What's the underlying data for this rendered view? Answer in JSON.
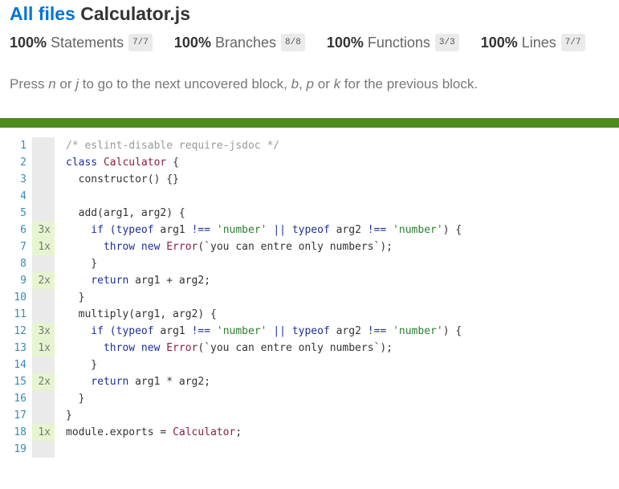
{
  "header": {
    "breadcrumb_label": "All files",
    "file_name": "Calculator.js"
  },
  "stats": [
    {
      "pct": "100%",
      "label": "Statements",
      "fraction": "7/7"
    },
    {
      "pct": "100%",
      "label": "Branches",
      "fraction": "8/8"
    },
    {
      "pct": "100%",
      "label": "Functions",
      "fraction": "3/3"
    },
    {
      "pct": "100%",
      "label": "Lines",
      "fraction": "7/7"
    }
  ],
  "hint": {
    "prefix": "Press ",
    "key_n": "n",
    "or1": " or ",
    "key_j": "j",
    "mid": " to go to the next uncovered block, ",
    "key_b": "b",
    "comma": ", ",
    "key_p": "p",
    "or2": " or ",
    "key_k": "k",
    "suffix": " for the previous block."
  },
  "colors": {
    "status_bar": "#4d8b1f",
    "link": "#0074d9",
    "covered_bg": "#e6f5d0",
    "gutter_bg": "#eaeaea"
  },
  "code": {
    "lines": [
      {
        "num": "1",
        "count": "",
        "tokens": [
          {
            "t": "/* eslint-disable require-jsdoc */",
            "c": "comment"
          }
        ]
      },
      {
        "num": "2",
        "count": "",
        "tokens": [
          {
            "t": "class ",
            "c": "kw"
          },
          {
            "t": "Calculator",
            "c": "cls"
          },
          {
            "t": " {",
            "c": "punc"
          }
        ]
      },
      {
        "num": "3",
        "count": "",
        "tokens": [
          {
            "t": "  constructor() {}",
            "c": "fn"
          }
        ]
      },
      {
        "num": "4",
        "count": "",
        "tokens": []
      },
      {
        "num": "5",
        "count": "",
        "tokens": [
          {
            "t": "  add(arg1, arg2) {",
            "c": "fn"
          }
        ]
      },
      {
        "num": "6",
        "count": "3x",
        "tokens": [
          {
            "t": "    if (",
            "c": "kw"
          },
          {
            "t": "typeof",
            "c": "kw"
          },
          {
            "t": " arg1 ",
            "c": "fn"
          },
          {
            "t": "!==",
            "c": "kw"
          },
          {
            "t": " ",
            "c": "fn"
          },
          {
            "t": "'number'",
            "c": "str"
          },
          {
            "t": " || ",
            "c": "kw"
          },
          {
            "t": "typeof",
            "c": "kw"
          },
          {
            "t": " arg2 ",
            "c": "fn"
          },
          {
            "t": "!==",
            "c": "kw"
          },
          {
            "t": " ",
            "c": "fn"
          },
          {
            "t": "'number'",
            "c": "str"
          },
          {
            "t": ") {",
            "c": "punc"
          }
        ]
      },
      {
        "num": "7",
        "count": "1x",
        "tokens": [
          {
            "t": "      throw new ",
            "c": "kw"
          },
          {
            "t": "Error",
            "c": "cls"
          },
          {
            "t": "(`you can entre only numbers`);",
            "c": "fn"
          }
        ]
      },
      {
        "num": "8",
        "count": "",
        "tokens": [
          {
            "t": "    }",
            "c": "punc"
          }
        ]
      },
      {
        "num": "9",
        "count": "2x",
        "tokens": [
          {
            "t": "    return",
            "c": "kw"
          },
          {
            "t": " arg1 + arg2;",
            "c": "fn"
          }
        ]
      },
      {
        "num": "10",
        "count": "",
        "tokens": [
          {
            "t": "  }",
            "c": "punc"
          }
        ]
      },
      {
        "num": "11",
        "count": "",
        "tokens": [
          {
            "t": "  multiply(arg1, arg2) {",
            "c": "fn"
          }
        ]
      },
      {
        "num": "12",
        "count": "3x",
        "tokens": [
          {
            "t": "    if (",
            "c": "kw"
          },
          {
            "t": "typeof",
            "c": "kw"
          },
          {
            "t": " arg1 ",
            "c": "fn"
          },
          {
            "t": "!==",
            "c": "kw"
          },
          {
            "t": " ",
            "c": "fn"
          },
          {
            "t": "'number'",
            "c": "str"
          },
          {
            "t": " || ",
            "c": "kw"
          },
          {
            "t": "typeof",
            "c": "kw"
          },
          {
            "t": " arg2 ",
            "c": "fn"
          },
          {
            "t": "!==",
            "c": "kw"
          },
          {
            "t": " ",
            "c": "fn"
          },
          {
            "t": "'number'",
            "c": "str"
          },
          {
            "t": ") {",
            "c": "punc"
          }
        ]
      },
      {
        "num": "13",
        "count": "1x",
        "tokens": [
          {
            "t": "      throw new ",
            "c": "kw"
          },
          {
            "t": "Error",
            "c": "cls"
          },
          {
            "t": "(`you can entre only numbers`);",
            "c": "fn"
          }
        ]
      },
      {
        "num": "14",
        "count": "",
        "tokens": [
          {
            "t": "    }",
            "c": "punc"
          }
        ]
      },
      {
        "num": "15",
        "count": "2x",
        "tokens": [
          {
            "t": "    return",
            "c": "kw"
          },
          {
            "t": " arg1 * arg2;",
            "c": "fn"
          }
        ]
      },
      {
        "num": "16",
        "count": "",
        "tokens": [
          {
            "t": "  }",
            "c": "punc"
          }
        ]
      },
      {
        "num": "17",
        "count": "",
        "tokens": [
          {
            "t": "}",
            "c": "punc"
          }
        ]
      },
      {
        "num": "18",
        "count": "1x",
        "tokens": [
          {
            "t": "module.exports = ",
            "c": "fn"
          },
          {
            "t": "Calculator",
            "c": "cls"
          },
          {
            "t": ";",
            "c": "punc"
          }
        ]
      },
      {
        "num": "19",
        "count": "",
        "tokens": []
      }
    ]
  }
}
